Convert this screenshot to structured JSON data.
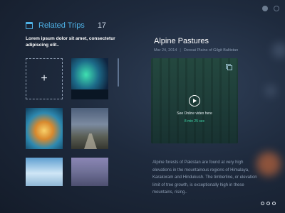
{
  "related": {
    "title": "Related Trips",
    "count": "17",
    "subtitle": "Lorem ipsum dolor sit amet, consectetur adipiscing elit..",
    "add_symbol": "+",
    "tiles": [
      "aurora",
      "wave",
      "road",
      "waterfalls",
      "misty-forest"
    ]
  },
  "detail": {
    "title": "Alpine Pastures",
    "date": "Mar 24, 2014",
    "location": "Deosai Plains of Gilgit Baltistan",
    "video_label": "See Online video here",
    "video_duration": "8 min 25 sec",
    "description": "Alpine forests of Pakistan are found at very high elevations in the mountainous regions of Himalaya, Karakoram and Hindukush. The timberline, or elevation limit of tree growth, is exceptionally high in these mountains, rising..",
    "accent": "#4fb3e8",
    "duration_color": "#3ed1a5"
  },
  "icons": [
    "user-icon",
    "settings-icon",
    "calendar-icon",
    "copy-icon",
    "play-icon",
    "more-icon"
  ]
}
